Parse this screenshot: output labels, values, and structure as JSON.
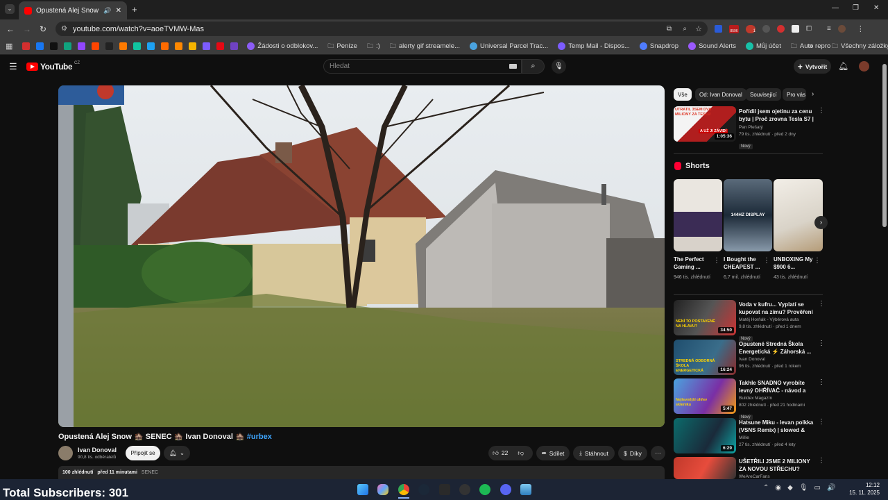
{
  "browser": {
    "tab_title": "Opustená Alej Snow 🏚️ SE",
    "url": "youtube.com/watch?v=aoeTVMW-Mas",
    "ext_badge": "8596",
    "ext_badge2": "1"
  },
  "bookmarks": [
    {
      "label": "Žádosti o odblokov...",
      "color": "#8b5cf6"
    },
    {
      "label": "Peníze",
      "color": "folder"
    },
    {
      "label": ":)",
      "color": "folder"
    },
    {
      "label": "alerty gif streamele...",
      "color": "folder"
    },
    {
      "label": "Universal Parcel Trac...",
      "color": "#4aa3df"
    },
    {
      "label": "Temp Mail - Dispos...",
      "color": "#7c5cff"
    },
    {
      "label": "Snapdrop",
      "color": "#4f7cff"
    },
    {
      "label": "Sound Alerts",
      "color": "#9b59ff"
    },
    {
      "label": "Můj účet",
      "color": "#18c1a8"
    },
    {
      "label": "Auto repro",
      "color": "folder"
    }
  ],
  "bookmarks_all": "Všechny záložky",
  "youtube": {
    "logo": "YouTube",
    "country": "CZ",
    "search_placeholder": "Hledat",
    "create": "Vytvořit"
  },
  "video": {
    "title": "Opustená Alej Snow 🏚️ SENEC 🏚️ Ivan Donoval 🏚️",
    "hashtag": "#urbex",
    "channel": "Ivan Donoval",
    "subscribers": "90,8 tis. odběratelů",
    "join": "Připojit se",
    "likes": "22",
    "share": "Sdílet",
    "download": "Stáhnout",
    "thanks": "Díky",
    "views": "100 zhlédnutí",
    "time": "před 11 minutami",
    "location": "SENEC"
  },
  "chips": [
    "Vše",
    "Od: Ivan Donoval",
    "Související",
    "Pro vás"
  ],
  "top_rec": {
    "title": "Pořídil jsem ojetinu za cenu bytu | Proč zrovna Tesla S7 | A ...",
    "channel": "Pan Plešatý",
    "meta": "79 tis. zhlédnutí · před 2 dny",
    "badge": "Nový",
    "duration": "1:05:36",
    "thumb_caption1": "UTRATIL 3SEM DVA MILIONY ZA TESLU",
    "thumb_caption2": "A UŽ JI ZÁVIDÍ"
  },
  "shorts_title": "Shorts",
  "shorts": [
    {
      "title": "The Perfect Gaming ...",
      "views": "946 tis. zhlédnutí"
    },
    {
      "title": "I Bought the CHEAPEST ...",
      "views": "6,7 mil. zhlédnutí",
      "caption": "144HZ DISPLAY"
    },
    {
      "title": "UNBOXING My $900 6...",
      "views": "43 tis. zhlédnutí"
    }
  ],
  "recs": [
    {
      "title": "Voda v kufru... Vyplatí se kupovat na zimu? Prověření ...",
      "channel": "Matěj Horňák - Výběrová auta",
      "meta": "9,8 tis. zhlédnutí · před 1 dnem",
      "badge": "Nový",
      "duration": "34:50",
      "caption": "NENÍ TO POSTAVENÉ NA HLAVU?"
    },
    {
      "title": "Opustené Stredná Škola Energetická ⚡ Záhorská ...",
      "channel": "Ivan Donoval",
      "meta": "96 tis. zhlédnutí · před 1 rokem",
      "badge": "",
      "duration": "16:24",
      "caption": "STREDNÁ ODBORNÁ ŠKOLA ENERGETICKÁ"
    },
    {
      "title": "Takhle SNADNO vyrobíte levný OHŘÍVAČ - návod a test ...",
      "channel": "Buildex Magazín",
      "meta": "802 zhlédnutí · před 21 hodinami",
      "badge": "Nový",
      "duration": "5:47",
      "caption": "Nejlevnější ohřev skleníku"
    },
    {
      "title": "Hatsune Miku - levan polkka (VSNS Remix) | slowed & rever...",
      "channel": "Millie",
      "meta": "27 tis. zhlédnutí · před 4 lety",
      "badge": "",
      "duration": "6:29",
      "caption": ""
    },
    {
      "title": "UŠETŘILI JSME 2 MILIONY ZA NOVOU STŘECHU? Oprava ...",
      "channel": "WeAreCarFans",
      "meta": "",
      "badge": "",
      "duration": "",
      "caption": ""
    }
  ],
  "overlay": "Total Subscribers: 301",
  "clock": {
    "time": "12:12",
    "date": "15. 11. 2025"
  }
}
